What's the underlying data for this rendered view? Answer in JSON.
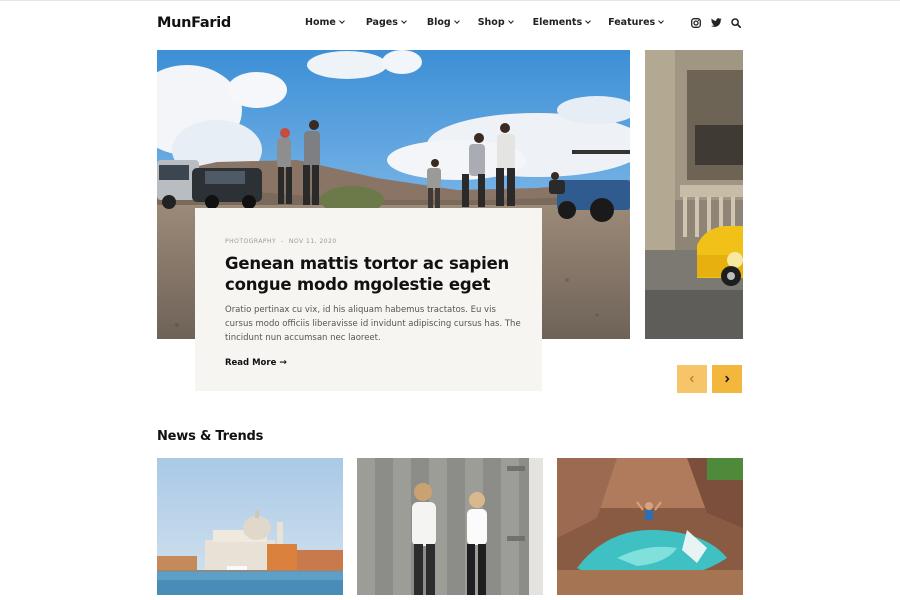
{
  "brand": {
    "logo": "MunFarid"
  },
  "nav": {
    "items": [
      {
        "label": "Home"
      },
      {
        "label": "Pages"
      },
      {
        "label": "Blog"
      },
      {
        "label": "Shop"
      },
      {
        "label": "Elements"
      },
      {
        "label": "Features"
      }
    ]
  },
  "header_icons": [
    "instagram-icon",
    "twitter-icon",
    "search-icon"
  ],
  "featured": {
    "category": "PHOTOGRAPHY",
    "separator": "-",
    "date": "NOV 11, 2020",
    "title": "Genean mattis tortor ac sapien congue modo mgolestie eget",
    "excerpt": "Oratio pertinax cu vix, id his aliquam habemus tractatos. Eu vis cursus modo officiis liberavisse id invidunt adipiscing cursus has. The tincidunt nun accumsan nec laoreet.",
    "read_more": "Read More",
    "read_more_arrow": "→"
  },
  "slider_controls": {
    "prev": "‹",
    "next": "›"
  },
  "news": {
    "title": "News & Trends"
  },
  "colors": {
    "accent": "#f4b73d",
    "card_bg": "#f7f5f2",
    "text": "#111111"
  }
}
